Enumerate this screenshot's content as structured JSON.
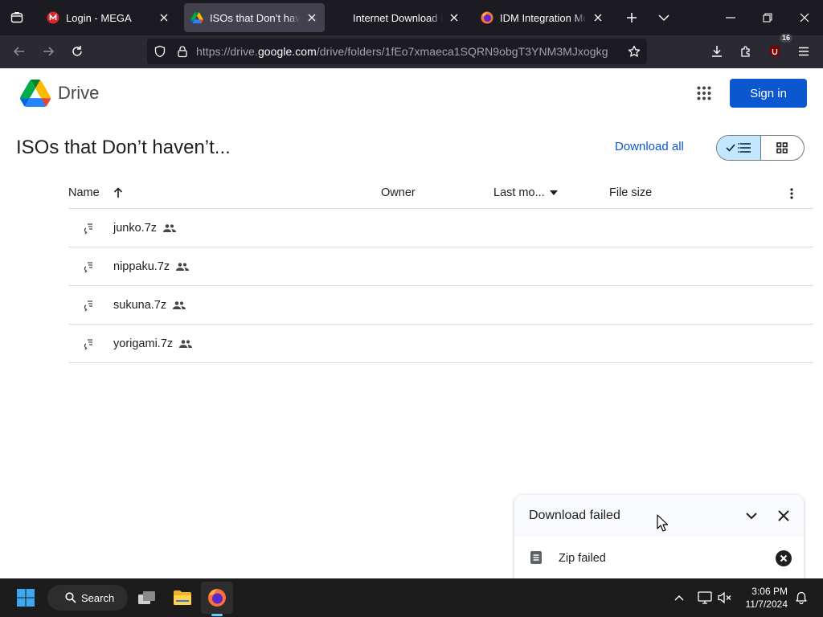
{
  "browser": {
    "tabs": [
      {
        "title": "Login - MEGA",
        "favicon": "mega-icon",
        "active": false
      },
      {
        "title": "ISOs that Don’t haven’t",
        "favicon": "google-drive-icon",
        "active": true
      },
      {
        "title": "Internet Download Manager",
        "favicon": "none",
        "active": false
      },
      {
        "title": "IDM Integration Module",
        "favicon": "firefox-icon",
        "active": false
      }
    ],
    "url_prefix": "https://drive.",
    "url_host": "google.com",
    "url_path": "/drive/folders/1fEo7xmaeca1SQRN9obgT3YNM3MJxogkg",
    "extension_badge": "16"
  },
  "drive": {
    "logo_text": "Drive",
    "sign_in": "Sign in",
    "folder_title": "ISOs that Don’t haven’t...",
    "download_all": "Download all",
    "columns": {
      "name": "Name",
      "owner": "Owner",
      "last_modified": "Last mo...",
      "file_size": "File size"
    },
    "files": [
      {
        "name": "junko.7z",
        "shared": true
      },
      {
        "name": "nippaku.7z",
        "shared": true
      },
      {
        "name": "sukuna.7z",
        "shared": true
      },
      {
        "name": "yorigami.7z",
        "shared": true
      }
    ]
  },
  "download_panel": {
    "title": "Download failed",
    "item": "Zip failed"
  },
  "taskbar": {
    "search_label": "Search",
    "time": "3:06 PM",
    "date": "11/7/2024"
  },
  "colors": {
    "accent_blue": "#0b57d0",
    "toggle_selected": "#c2e7ff",
    "firefox_tabbar": "#1c1b22",
    "firefox_toolbar": "#2b2a33"
  }
}
